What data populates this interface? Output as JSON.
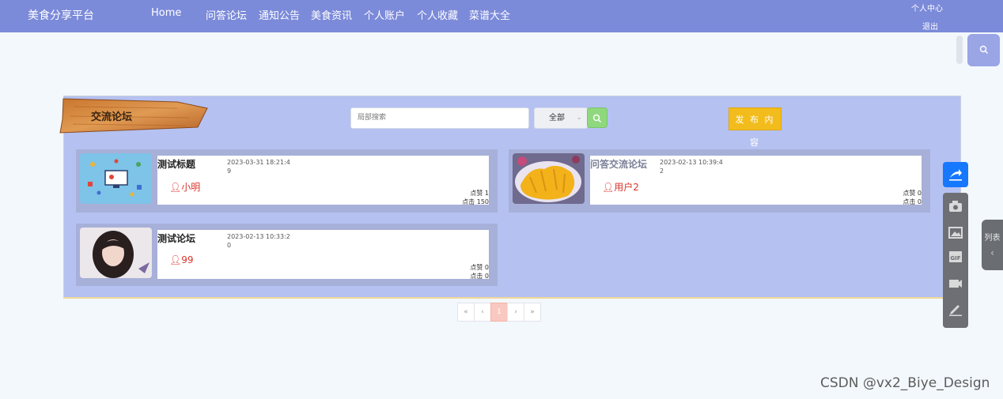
{
  "header": {
    "brand": "美食分享平台",
    "nav": [
      "Home",
      "问答论坛",
      "通知公告",
      "美食资讯",
      "个人账户",
      "个人收藏",
      "菜谱大全"
    ],
    "account": [
      "个人中心",
      "退出"
    ]
  },
  "forum": {
    "section_title": "交流论坛",
    "search_placeholder": "局部搜索",
    "filter_selected": "全部",
    "publish_label": "发 布 内 容"
  },
  "posts": [
    {
      "title": "测试标题",
      "date": "2023-03-31 18:21:4",
      "num": "9",
      "author": "小明",
      "likes": "点赞 1",
      "clicks": "点击 150"
    },
    {
      "title": "问答交流论坛",
      "date": "2023-02-13 10:39:4",
      "num": "2",
      "author": "用户2",
      "likes": "点赞 0",
      "clicks": "点击 0"
    },
    {
      "title": "测试论坛",
      "date": "2023-02-13 10:33:2",
      "num": "0",
      "author": "99",
      "likes": "点赞 0",
      "clicks": "点击 0"
    }
  ],
  "pagination": [
    "«",
    "‹",
    "1",
    "›",
    "»"
  ],
  "side_tab": {
    "label": "列表"
  },
  "watermark": "CSDN @vx2_Biye_Design",
  "colors": {
    "nav": "#7b8ad9",
    "panel": "#b5c1f1",
    "card": "#a7b0d8",
    "publish": "#f2bc1c",
    "search_btn": "#8fd87d",
    "author": "#d9342b",
    "active_page": "#f9c8c0",
    "share": "#1677ff"
  },
  "icons": {
    "search_float": "search-icon",
    "search_button": "search-icon",
    "author": "user-icon",
    "share": "share-icon",
    "toolbar": [
      "camera-icon",
      "image-icon",
      "gif-icon",
      "video-icon",
      "pen-icon"
    ],
    "side_tab": "chevron-left-icon"
  }
}
